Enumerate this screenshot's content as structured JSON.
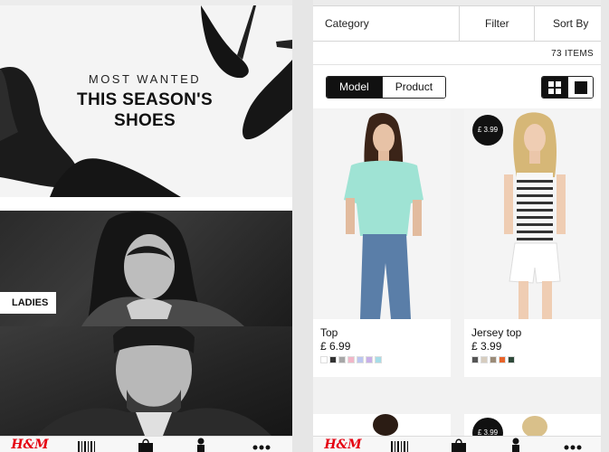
{
  "left_screen": {
    "hero": {
      "kicker": "MOST WANTED",
      "title_line1": "THIS SEASON'S",
      "title_line2": "SHOES"
    },
    "category_label": "LADIES",
    "tabbar": {
      "logo": "H&M",
      "items": [
        "hm-logo-icon",
        "barcode-icon",
        "shopping-bag-icon",
        "profile-icon",
        "more-icon"
      ]
    }
  },
  "right_screen": {
    "filterbar": {
      "category": "Category",
      "filter": "Filter",
      "sort": "Sort By"
    },
    "item_count": "73 ITEMS",
    "view_mode": {
      "options": [
        "Model",
        "Product"
      ],
      "selected": "Model"
    },
    "grid_toggle": {
      "selected": "grid-4-icon"
    },
    "products": [
      {
        "name": "Top",
        "price": "£ 6.99",
        "badge": "",
        "swatches": [
          "#ffffff",
          "#333333",
          "#a7a7a7",
          "#f2b6c8",
          "#bcc6f0",
          "#c8b0e8",
          "#a7dde8"
        ]
      },
      {
        "name": "Jersey top",
        "price": "£ 3.99",
        "badge": "£ 3.99",
        "swatches": [
          "#555555",
          "#d7cdbf",
          "#9b8b78",
          "#e8642a",
          "#2f4a3a"
        ]
      }
    ],
    "next_row_badge": "£ 3.99",
    "tabbar": {
      "logo": "H&M",
      "items": [
        "hm-logo-icon",
        "barcode-icon",
        "shopping-bag-icon",
        "profile-icon",
        "more-icon"
      ]
    }
  },
  "colors": {
    "brand_red": "#e50010",
    "black": "#111111"
  }
}
